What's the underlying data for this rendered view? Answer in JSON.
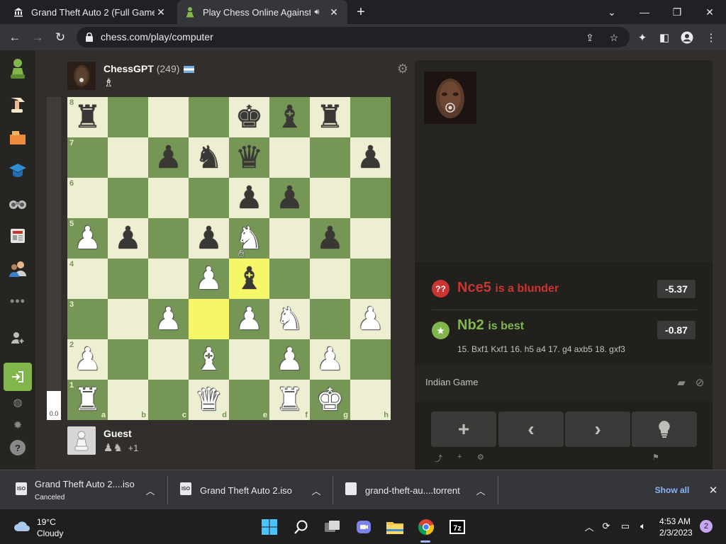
{
  "browser": {
    "tabs": [
      {
        "title": "Grand Theft Auto 2 (Full Game) :",
        "favicon": "archive-icon",
        "active": false
      },
      {
        "title": "Play Chess Online Against th",
        "favicon": "chess-pawn-icon",
        "active": true
      }
    ],
    "url": "chess.com/play/computer",
    "window_controls": [
      "chevron-down-icon",
      "minimize-icon",
      "restore-icon",
      "close-icon"
    ]
  },
  "sidebar": {
    "items": [
      "chess-logo",
      "play-icon",
      "puzzles-icon",
      "learn-icon",
      "watch-icon",
      "news-icon",
      "social-icon",
      "more-icon"
    ],
    "login_icon": "sign-in-icon",
    "bottom_icons": [
      "globe-icon",
      "brightness-icon",
      "help-icon"
    ]
  },
  "game": {
    "opponent": {
      "name": "ChessGPT",
      "rating": "(249)",
      "flag": "flag-icon",
      "captured_icon": "white-bishop-icon"
    },
    "player": {
      "name": "Guest",
      "captured_extra": "+1"
    },
    "eval_score": "0.0",
    "eval_white_fraction": 0.09,
    "files": [
      "a",
      "b",
      "c",
      "d",
      "e",
      "f",
      "g",
      "h"
    ],
    "ranks": [
      "8",
      "7",
      "6",
      "5",
      "4",
      "3",
      "2",
      "1"
    ],
    "board": [
      [
        "r",
        "",
        "",
        "",
        "k",
        "b",
        "r",
        ""
      ],
      [
        "",
        "",
        "p",
        "n",
        "q",
        "",
        "",
        "p"
      ],
      [
        "",
        "",
        "",
        "",
        "p",
        "p",
        "",
        ""
      ],
      [
        "P",
        "p",
        "",
        "p",
        "N",
        "",
        "p",
        ""
      ],
      [
        "",
        "",
        "",
        "P",
        "b",
        "",
        "",
        ""
      ],
      [
        "",
        "",
        "P",
        "",
        "P",
        "N",
        "",
        "P"
      ],
      [
        "P",
        "",
        "",
        "B",
        "",
        "P",
        "P",
        ""
      ],
      [
        "R",
        "",
        "",
        "Q",
        "",
        "R",
        "K",
        ""
      ]
    ],
    "highlight_squares": [
      "e4",
      "d3"
    ]
  },
  "review": {
    "blunder": {
      "move": "Nce5",
      "label": "is a blunder",
      "score": "-5.37",
      "icon": "??"
    },
    "best": {
      "move": "Nb2",
      "label": "is best",
      "score": "-0.87",
      "line": "15. Bxf1 Kxf1 16. h5 a4 17. g4 axb5 18. gxf3"
    },
    "opening": "Indian Game",
    "controls": [
      "+",
      "‹",
      "›",
      "hint-icon"
    ]
  },
  "downloads": [
    {
      "name": "Grand Theft Auto 2....iso",
      "status": "Canceled",
      "type": "ISO"
    },
    {
      "name": "Grand Theft Auto 2.iso",
      "status": "",
      "type": "ISO"
    },
    {
      "name": "grand-theft-au....torrent",
      "status": "",
      "type": "file"
    }
  ],
  "downloads_show_all": "Show all",
  "taskbar": {
    "weather_temp": "19°C",
    "weather_desc": "Cloudy",
    "time": "4:53 AM",
    "date": "2/3/2023",
    "notifications": "2"
  },
  "colors": {
    "board_light": "#eeeed2",
    "board_dark": "#769656",
    "highlight": "#f6f669",
    "blunder": "#ca3431",
    "best": "#81b64c",
    "accent_green": "#81b64c"
  }
}
